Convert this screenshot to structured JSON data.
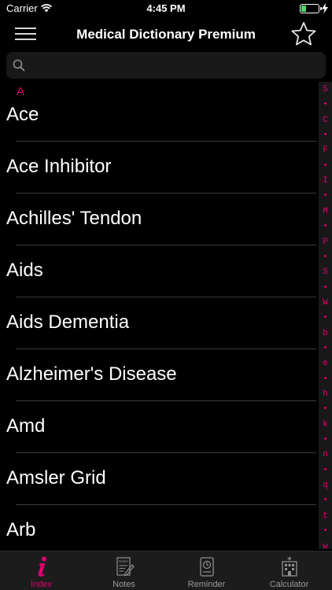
{
  "status_bar": {
    "carrier": "Carrier",
    "time": "4:45 PM",
    "battery_level": 0.3
  },
  "nav": {
    "title": "Medical Dictionary Premium"
  },
  "search": {
    "placeholder": "",
    "value": ""
  },
  "section": {
    "letter": "A"
  },
  "terms": [
    "Ace",
    "Ace Inhibitor",
    "Achilles' Tendon",
    "Aids",
    "Aids Dementia",
    "Alzheimer's Disease",
    "Amd",
    "Amsler Grid",
    "Arb"
  ],
  "index_strip": [
    "5",
    "•",
    "C",
    "•",
    "F",
    "•",
    "I",
    "•",
    "M",
    "•",
    "P",
    "•",
    "S",
    "•",
    "W",
    "•",
    "b",
    "•",
    "e",
    "•",
    "h",
    "•",
    "k",
    "•",
    "n",
    "•",
    "q",
    "•",
    "t",
    "•",
    "w"
  ],
  "tabs": [
    {
      "label": "Index",
      "icon": "info-icon",
      "active": true
    },
    {
      "label": "Notes",
      "icon": "notes-icon",
      "active": false
    },
    {
      "label": "Reminder",
      "icon": "reminder-icon",
      "active": false
    },
    {
      "label": "Calculator",
      "icon": "calculator-icon",
      "active": false
    }
  ],
  "colors": {
    "accent": "#e0006e",
    "background": "#000000",
    "tab_bar": "#1c1c1c",
    "battery": "#4cd964"
  }
}
